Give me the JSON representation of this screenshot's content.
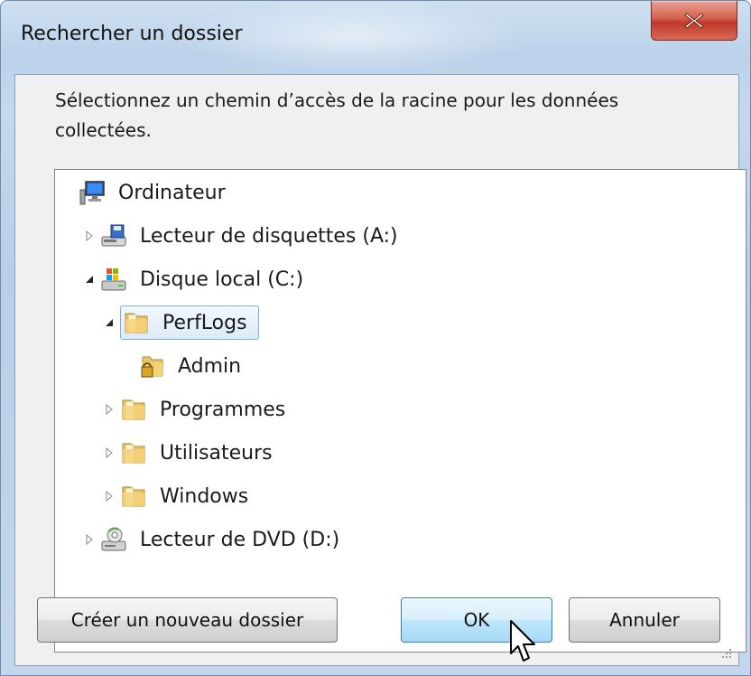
{
  "window": {
    "title": "Rechercher un dossier",
    "close_label": "X"
  },
  "prompt": "Sélectionnez un chemin d’accès de la racine pour les données collectées.",
  "tree": {
    "items": [
      {
        "label": "Ordinateur",
        "icon": "computer-icon",
        "expander": "none",
        "level": 0
      },
      {
        "label": "Lecteur de disquettes (A:)",
        "icon": "floppy-drive-icon",
        "expander": "collapsed",
        "level": 1
      },
      {
        "label": "Disque local (C:)",
        "icon": "local-disk-icon",
        "expander": "expanded",
        "level": 1
      },
      {
        "label": "PerfLogs",
        "icon": "folder-icon",
        "expander": "expanded",
        "level": 2,
        "selected": true
      },
      {
        "label": "Admin",
        "icon": "locked-folder-icon",
        "expander": "none",
        "level": 3
      },
      {
        "label": "Programmes",
        "icon": "folder-icon",
        "expander": "collapsed",
        "level": 2
      },
      {
        "label": "Utilisateurs",
        "icon": "folder-icon",
        "expander": "collapsed",
        "level": 2
      },
      {
        "label": "Windows",
        "icon": "folder-icon",
        "expander": "collapsed",
        "level": 2
      },
      {
        "label": "Lecteur de DVD (D:)",
        "icon": "dvd-drive-icon",
        "expander": "collapsed",
        "level": 1
      }
    ]
  },
  "buttons": {
    "new_folder": "Créer un nouveau dossier",
    "ok": "OK",
    "cancel": "Annuler"
  },
  "colors": {
    "selection_border": "#84acdd",
    "close_button": "#c0392b",
    "ok_button": "#bee6fd"
  }
}
